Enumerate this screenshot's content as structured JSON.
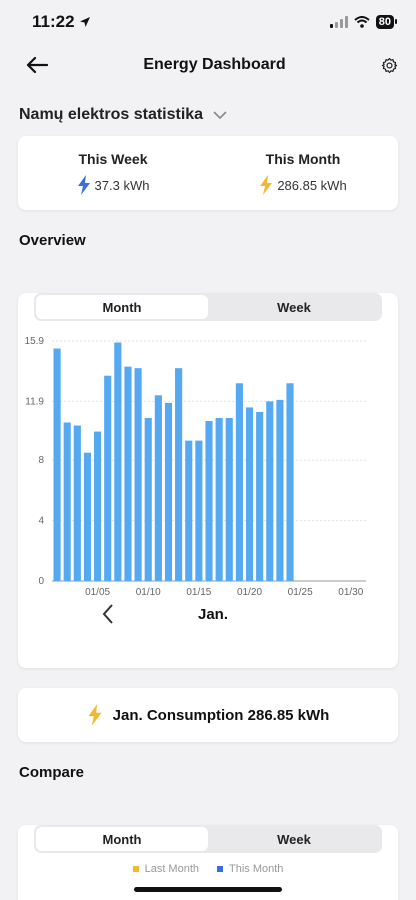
{
  "status": {
    "time": "11:22",
    "battery": "80"
  },
  "nav": {
    "title": "Energy Dashboard"
  },
  "selector": {
    "label": "Namų elektros statistika"
  },
  "summary": {
    "week_label": "This Week",
    "week_value": "37.3 kWh",
    "month_label": "This Month",
    "month_value": "286.85 kWh"
  },
  "overview": {
    "title": "Overview",
    "tab_month": "Month",
    "tab_week": "Week",
    "period": "Jan."
  },
  "consumption": {
    "text": "Jan. Consumption 286.85 kWh"
  },
  "compare": {
    "title": "Compare",
    "tab_month": "Month",
    "tab_week": "Week",
    "legend_last": "Last Month",
    "legend_this": "This Month"
  },
  "colors": {
    "bar": "#55a8f2",
    "accent_week": "#3a6de0",
    "accent_month": "#f5b82e",
    "legend_last": "#f5b82e",
    "legend_this": "#3a6de0"
  },
  "chart_data": {
    "type": "bar",
    "ylim": [
      0,
      15.9
    ],
    "yticks": [
      "0",
      "4",
      "8",
      "11.9",
      "15.9"
    ],
    "ytick_values": [
      0,
      4,
      8,
      11.9,
      15.9
    ],
    "xticks": [
      "01/05",
      "01/10",
      "01/15",
      "01/20",
      "01/25",
      "01/30"
    ],
    "xtick_days": [
      5,
      10,
      15,
      20,
      25,
      30
    ],
    "days": 31,
    "values": [
      15.4,
      10.5,
      10.3,
      8.5,
      9.9,
      13.6,
      15.8,
      14.2,
      14.1,
      10.8,
      12.3,
      11.8,
      14.1,
      9.3,
      9.3,
      10.6,
      10.8,
      10.8,
      13.1,
      11.5,
      11.2,
      11.9,
      12.0,
      13.1
    ]
  }
}
